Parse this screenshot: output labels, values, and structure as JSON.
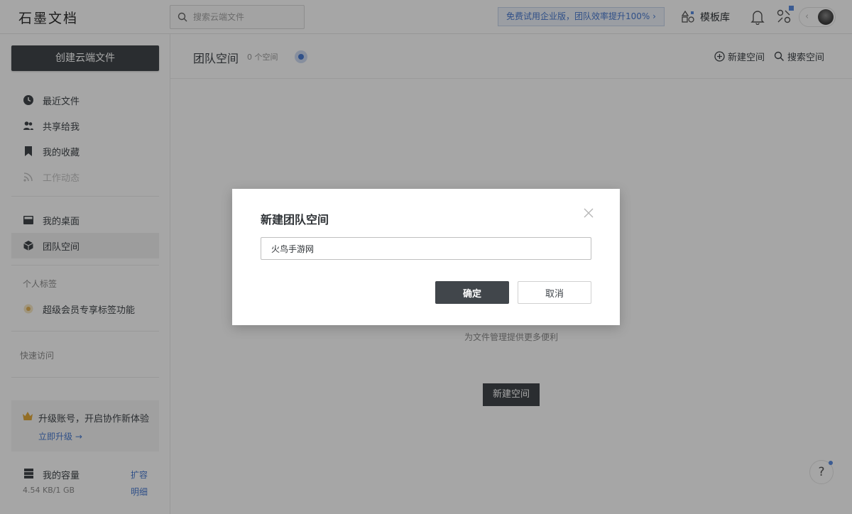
{
  "app": {
    "logo_text": "石墨文档"
  },
  "header": {
    "search_placeholder": "搜索云端文件",
    "trial_banner": "免费试用企业版，团队效率提升100% ›",
    "template_label": "模板库"
  },
  "sidebar": {
    "create_label": "创建云端文件",
    "items": [
      {
        "label": "最近文件"
      },
      {
        "label": "共享给我"
      },
      {
        "label": "我的收藏"
      },
      {
        "label": "工作动态"
      },
      {
        "label": "我的桌面"
      },
      {
        "label": "团队空间"
      }
    ],
    "tags_title": "个人标签",
    "tag_promo": "超级会员专享标签功能",
    "quick_title": "快速访问",
    "upgrade": {
      "title": "升级账号，开启协作新体验",
      "link": "立即升级 →"
    },
    "capacity": {
      "label": "我的容量",
      "usage": "4.54 KB/1 GB",
      "expand": "扩容",
      "detail": "明细"
    }
  },
  "main": {
    "title": "团队空间",
    "count": "0 个空间",
    "new_space": "新建空间",
    "search_space": "搜索空间",
    "empty_desc": "为文件管理提供更多便利",
    "empty_button": "新建空间",
    "help": "?"
  },
  "dialog": {
    "title": "新建团队空间",
    "input_value": "火鸟手游网",
    "ok_label": "确定",
    "cancel_label": "取消"
  },
  "colors": {
    "primary_dark": "#41464b",
    "link_blue": "#4a7bd1",
    "overlay": "rgba(0,0,0,0.35)"
  }
}
